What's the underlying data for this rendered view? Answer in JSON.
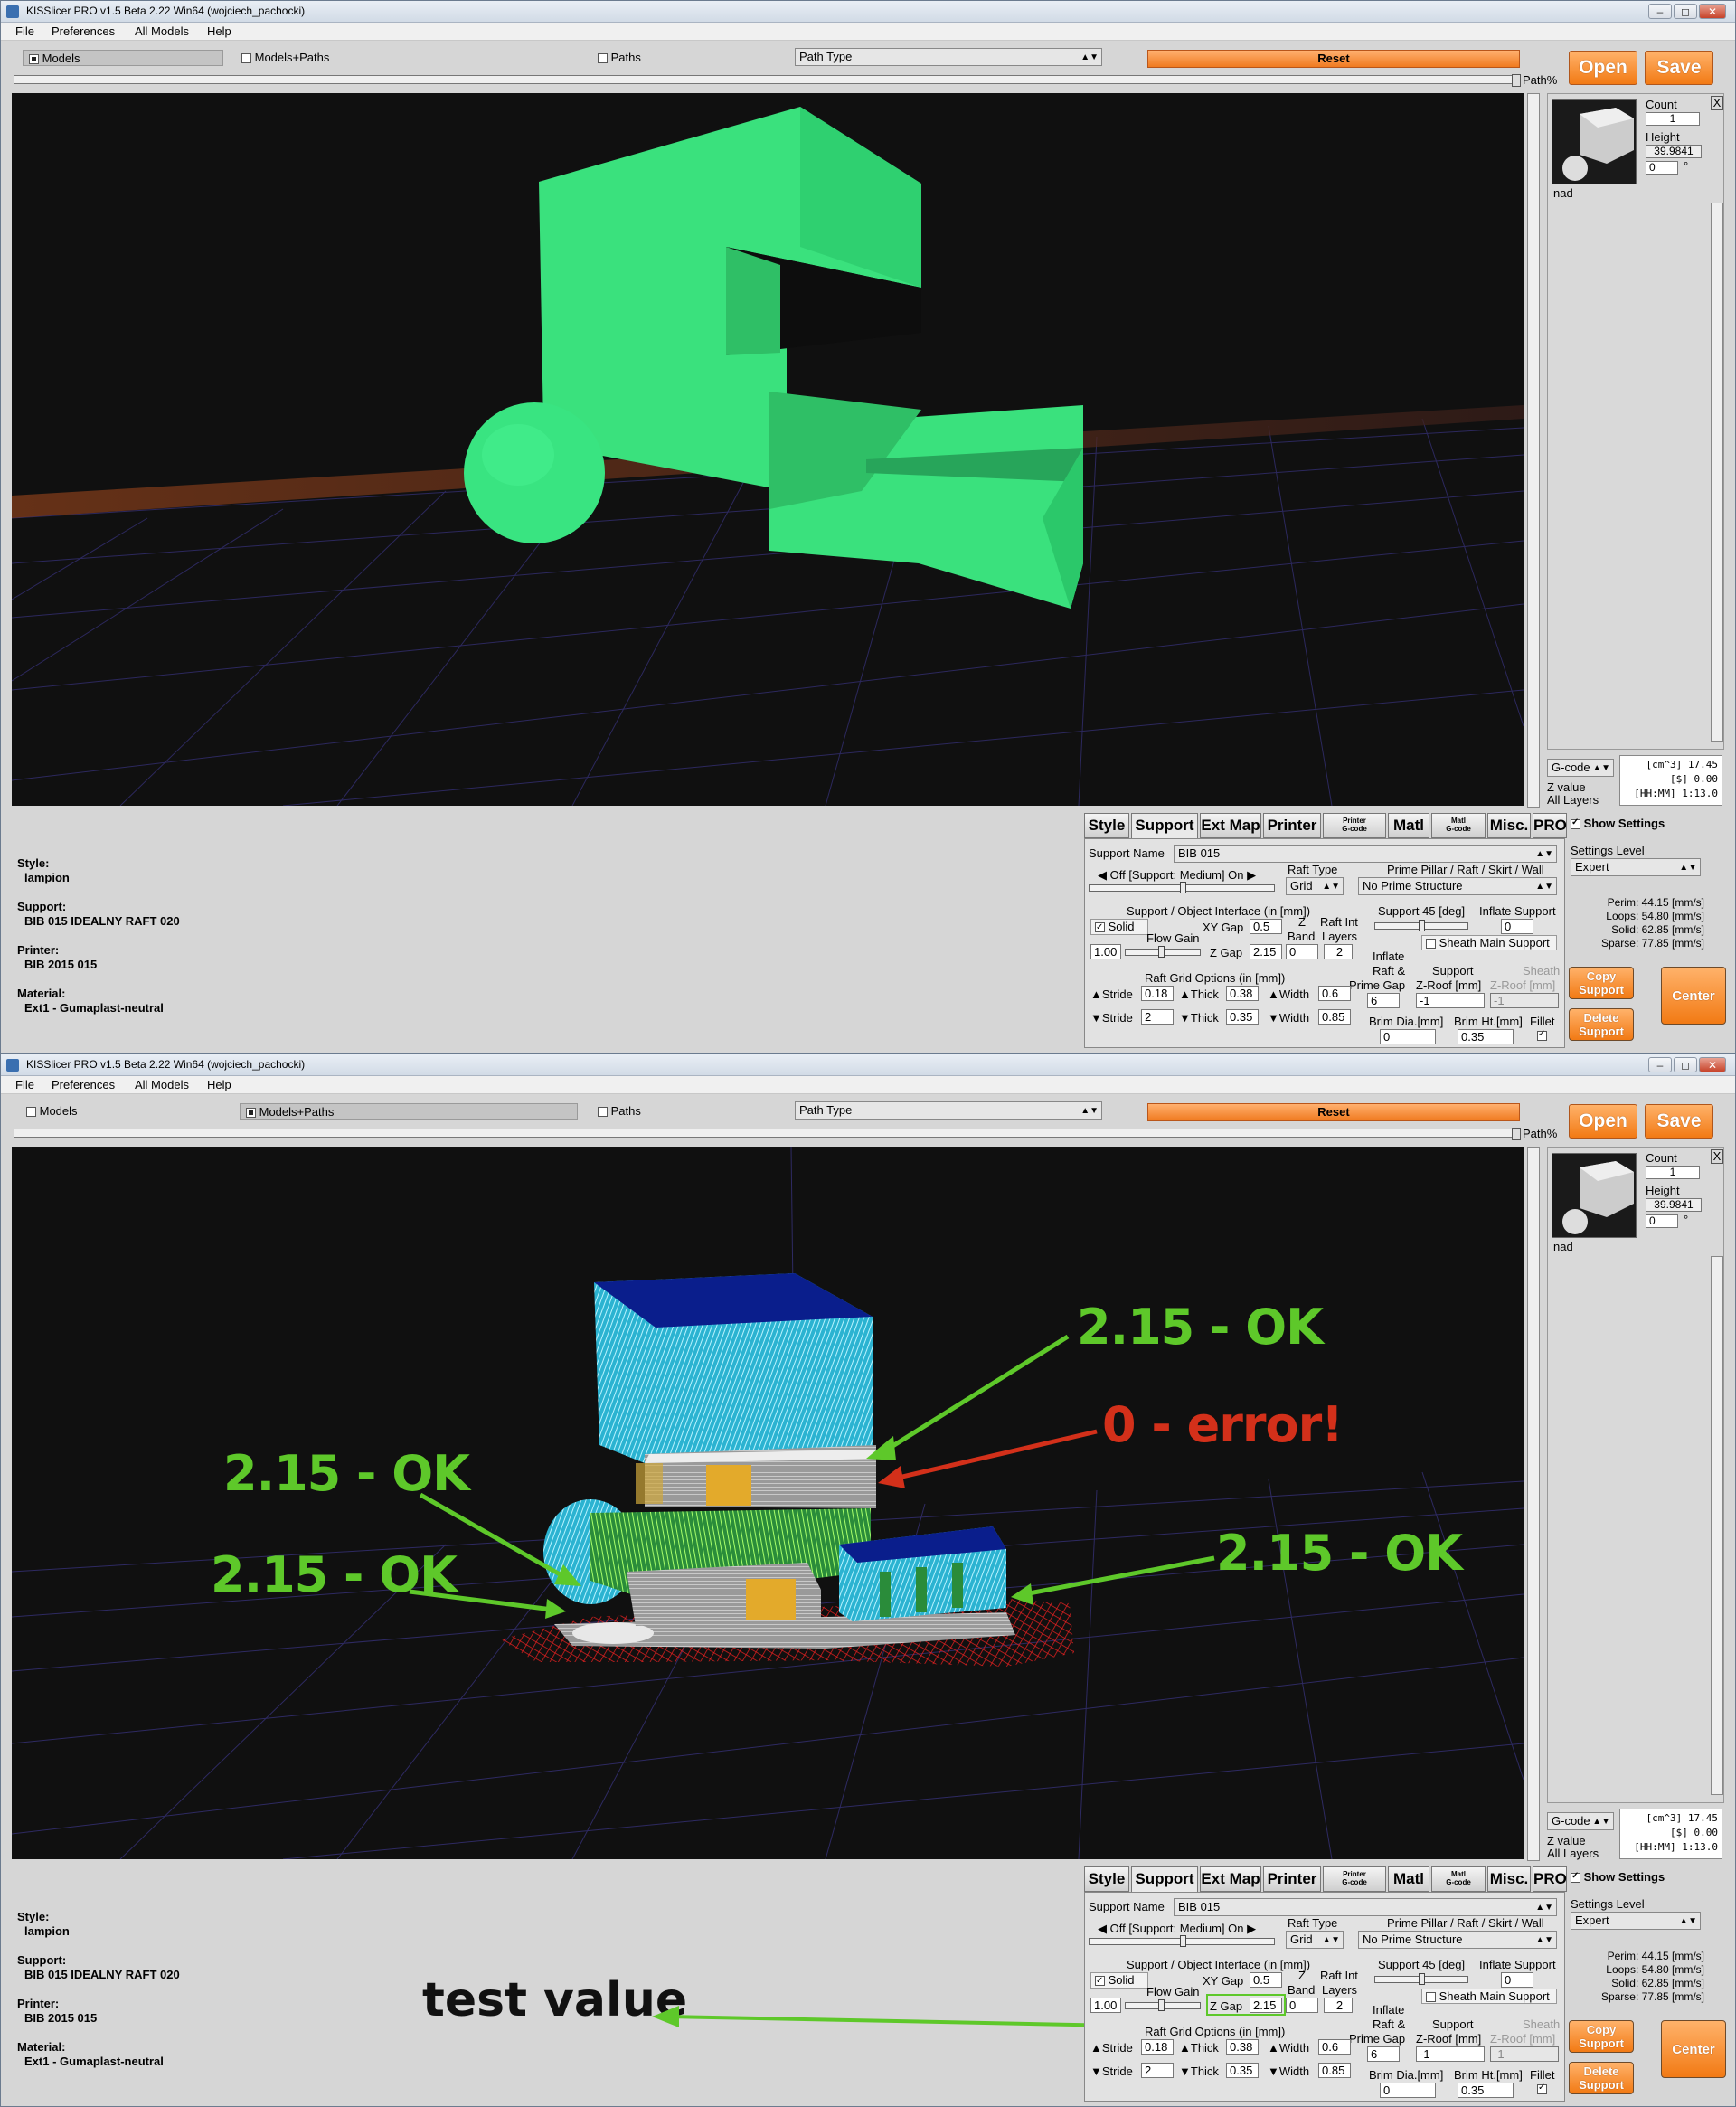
{
  "window": {
    "title": "KISSlicer PRO v1.5 Beta 2.22 Win64 (wojciech_pachocki)",
    "minimize": "▭",
    "maximize": "◻",
    "close": "✕"
  },
  "menu": [
    "File",
    "Preferences",
    "All Models",
    "Help"
  ],
  "toolbar": {
    "models_label": "Models",
    "models_paths_label": "Models+Paths",
    "paths_label": "Paths",
    "path_type": "Path Type",
    "reset_label": "Reset",
    "open_label": "Open",
    "save_label": "Save",
    "path_pct_label": "Path%"
  },
  "right_panel": {
    "count_label": "Count",
    "count_value": "1",
    "height_label": "Height",
    "height_value": "39.9841",
    "rotation_value": "0",
    "degree": "°",
    "close_x": "X",
    "model_name": "nad",
    "gcode_select": "G-code",
    "z_value_label": "Z value",
    "all_layers_label": "All Layers",
    "stats_lines": [
      "[cm^3] 17.45",
      "[$] 0.00",
      "[HH:MM] 1:13.0"
    ]
  },
  "info": {
    "style_label": "Style:",
    "style_value": "lampion",
    "support_label": "Support:",
    "support_value": "BIB 015 IDEALNY RAFT 020",
    "printer_label": "Printer:",
    "printer_value": "BIB 2015 015",
    "material_label": "Material:",
    "material_value": "Ext1 - Gumaplast-neutral"
  },
  "tabs": {
    "style": "Style",
    "support": "Support",
    "extmap": "Ext Map",
    "printer": "Printer",
    "printer_gcode_top": "Printer",
    "printer_gcode_bottom": "G-code",
    "matl": "Matl",
    "matl_gcode_top": "Matl",
    "matl_gcode_bottom": "G-code",
    "misc": "Misc.",
    "pro": "PRO"
  },
  "support_settings": {
    "support_name_label": "Support Name",
    "support_name_value": "BIB 015",
    "off_on_label": "Off [Support: Medium] On",
    "raft_type_label": "Raft Type",
    "raft_type_value": "Grid",
    "prime_pillar_label": "Prime Pillar / Raft / Skirt / Wall",
    "prime_structure_value": "No Prime Structure",
    "interface_label": "Support / Object Interface (in [mm])",
    "solid_label": "Solid",
    "xy_gap_label": "XY Gap",
    "xy_gap_value": "0.5",
    "z_band_top": "Z",
    "z_band_bottom": "Band",
    "raft_int_top": "Raft Int",
    "raft_int_bottom": "Layers",
    "flow_gain_label": "Flow Gain",
    "flow_gain_value": "1.00",
    "z_gap_label": "Z Gap",
    "z_gap_value": "2.15",
    "z_band_value": "0",
    "raft_int_value": "2",
    "support45_label": "Support 45 [deg]",
    "inflate_support_label": "Inflate Support",
    "inflate_support_value": "0",
    "sheath_label": "Sheath Main Support",
    "inflate_raft_label": "Inflate",
    "inflate_raft_label2": "Raft &",
    "inflate_raft_label3": "Prime Gap",
    "inflate_raft_value": "6",
    "support_zroof_label": "Support",
    "support_zroof_label2": "Z-Roof [mm]",
    "support_zroof_value": "-1",
    "sheath_zroof_label": "Sheath",
    "sheath_zroof_label2": "Z-Roof [mm]",
    "sheath_zroof_value": "-1",
    "raft_grid_label": "Raft Grid Options (in [mm])",
    "stride1_label": "Stride",
    "stride1_value": "0.18",
    "thick1_label": "Thick",
    "thick1_value": "0.38",
    "width1_label": "Width",
    "width1_value": "0.6",
    "stride2_label": "Stride",
    "stride2_value": "2",
    "thick2_label": "Thick",
    "thick2_value": "0.35",
    "width2_label": "Width",
    "width2_value": "0.85",
    "brim_dia_label": "Brim Dia.[mm]",
    "brim_dia_value": "0",
    "brim_ht_label": "Brim Ht.[mm]",
    "brim_ht_value": "0.35",
    "fillet_label": "Fillet"
  },
  "side_settings": {
    "show_settings_label": "Show Settings",
    "settings_level_label": "Settings Level",
    "settings_level_value": "Expert",
    "speeds": [
      "Perim: 44.15 [mm/s]",
      "Loops: 54.80 [mm/s]",
      "Solid: 62.85 [mm/s]",
      "Sparse: 77.85 [mm/s]"
    ],
    "copy_support_label": "Copy Support",
    "delete_support_label": "Delete Support",
    "center_label": "Center"
  },
  "annotations": {
    "ok1": "2.15 - OK",
    "error": "0 - error!",
    "ok2": "2.15 - OK",
    "ok3": "2.15 - OK",
    "ok4": "2.15 - OK",
    "test_value": "test value",
    "green": "#5ec82a",
    "red": "#d3301a"
  }
}
